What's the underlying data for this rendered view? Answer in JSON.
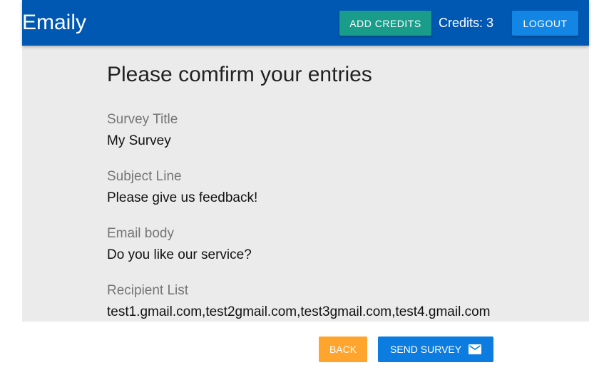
{
  "header": {
    "brand": "Emaily",
    "add_credits_label": "ADD CREDITS",
    "credits_text": "Credits: 3",
    "logout_label": "LOGOUT"
  },
  "main": {
    "title": "Please comfirm your entries",
    "fields": [
      {
        "label": "Survey Title",
        "value": "My Survey"
      },
      {
        "label": "Subject Line",
        "value": "Please give us feedback!"
      },
      {
        "label": "Email body",
        "value": "Do you like our service?"
      },
      {
        "label": "Recipient List",
        "value": "test1.gmail.com,test2gmail.com,test3gmail.com,test4.gmail.com"
      }
    ]
  },
  "actions": {
    "back_label": "BACK",
    "send_label": "SEND SURVEY",
    "send_icon": "email-icon"
  },
  "colors": {
    "navbar": "#0158b3",
    "add_credits": "#1a9c8b",
    "logout": "#1386e5",
    "back": "#ffa52e",
    "send": "#0d7ce0",
    "content_bg": "#ebebeb"
  }
}
